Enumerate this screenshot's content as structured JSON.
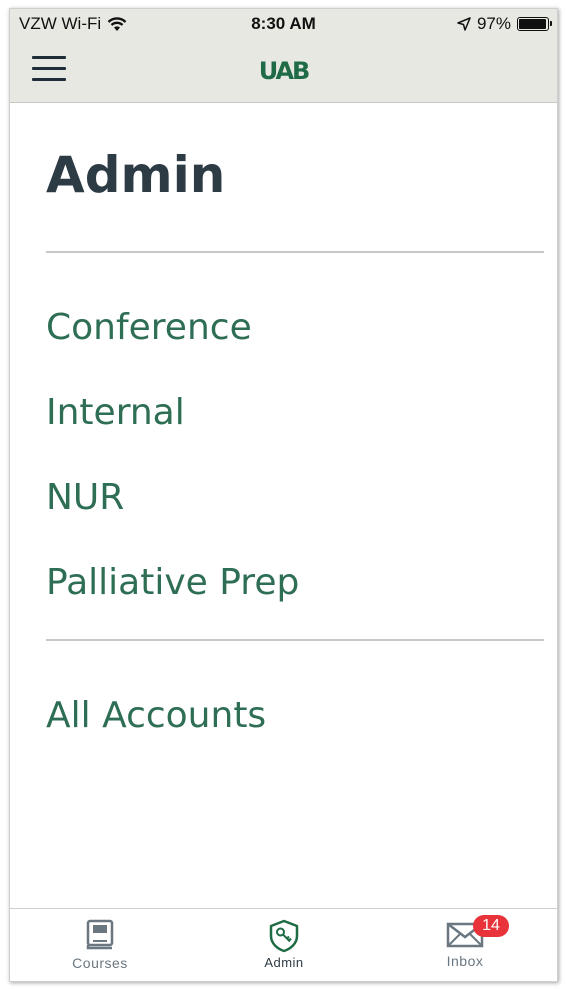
{
  "status_bar": {
    "carrier": "VZW Wi-Fi",
    "time": "8:30 AM",
    "battery": "97%",
    "battery_level": 0.97
  },
  "nav": {
    "logo_text": "UAB",
    "menu_icon": "hamburger-menu-icon"
  },
  "page": {
    "title": "Admin"
  },
  "accounts": [
    {
      "label": "Conference"
    },
    {
      "label": "Internal"
    },
    {
      "label": "NUR"
    },
    {
      "label": "Palliative Prep"
    }
  ],
  "all_accounts_label": "All Accounts",
  "tabs": [
    {
      "label": "Courses",
      "icon": "book-icon",
      "active": false
    },
    {
      "label": "Admin",
      "icon": "shield-key-icon",
      "active": true
    },
    {
      "label": "Inbox",
      "icon": "envelope-icon",
      "active": false,
      "badge": "14"
    }
  ],
  "colors": {
    "brand_green": "#1e6b46",
    "link_green": "#2e6e55",
    "title_dark": "#2d3b45",
    "badge_red": "#e8333a",
    "header_bg": "#e8e8e3"
  }
}
